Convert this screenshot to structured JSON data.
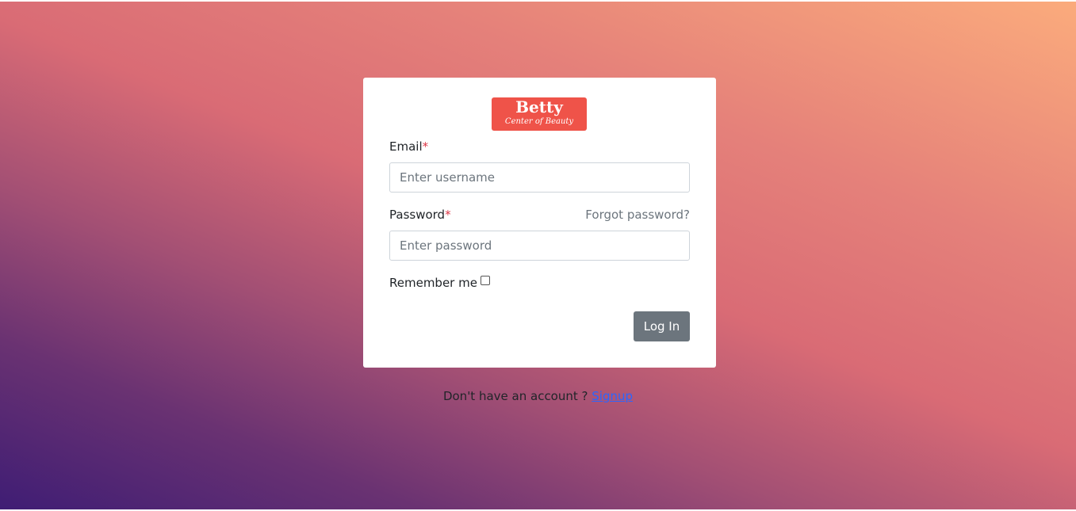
{
  "logo": {
    "title": "Betty",
    "subtitle": "Center of Beauty"
  },
  "form": {
    "email_label": "Email",
    "email_required": "*",
    "email_placeholder": "Enter username",
    "email_value": "",
    "password_label": "Password",
    "password_required": "*",
    "password_placeholder": "Enter password",
    "password_value": "",
    "forgot_link": "Forgot password?",
    "remember_label": "Remember me",
    "remember_checked": false,
    "login_button": "Log In"
  },
  "footer": {
    "prompt": "Don't have an account ?",
    "signup_link": "Signup"
  },
  "colors": {
    "logo_bg": "#ef5349",
    "button_bg": "#6c757d",
    "link": "#2a66ff",
    "required": "#dc3545"
  }
}
